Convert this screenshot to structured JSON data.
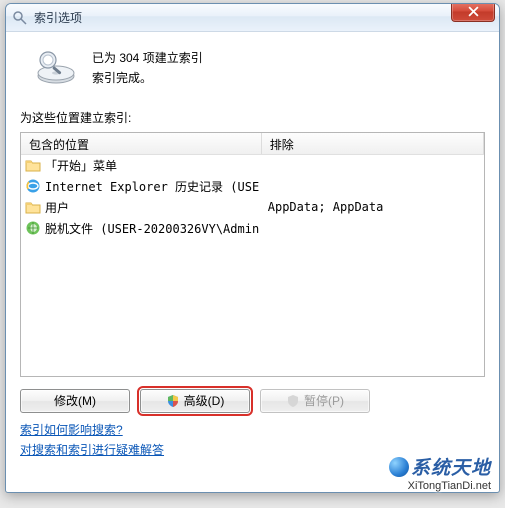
{
  "title": "索引选项",
  "status": {
    "line1": "已为 304 项建立索引",
    "line2": "索引完成。"
  },
  "section_label": "为这些位置建立索引:",
  "columns": {
    "included": "包含的位置",
    "excluded": "排除"
  },
  "rows": [
    {
      "icon": "folder",
      "name": "「开始」菜单",
      "excluded": ""
    },
    {
      "icon": "ie",
      "name": "Internet Explorer 历史记录 (USE...",
      "excluded": ""
    },
    {
      "icon": "folder",
      "name": "用户",
      "excluded": "AppData; AppData"
    },
    {
      "icon": "offline",
      "name": "脱机文件 (USER-20200326VY\\Admin...",
      "excluded": ""
    }
  ],
  "buttons": {
    "modify": "修改(M)",
    "advanced": "高级(D)",
    "pause": "暂停(P)"
  },
  "links": {
    "help": "索引如何影响搜索?",
    "troubleshoot": "对搜索和索引进行疑难解答"
  },
  "watermark": {
    "main": "系统天地",
    "sub": "XiTongTianDi.net"
  }
}
